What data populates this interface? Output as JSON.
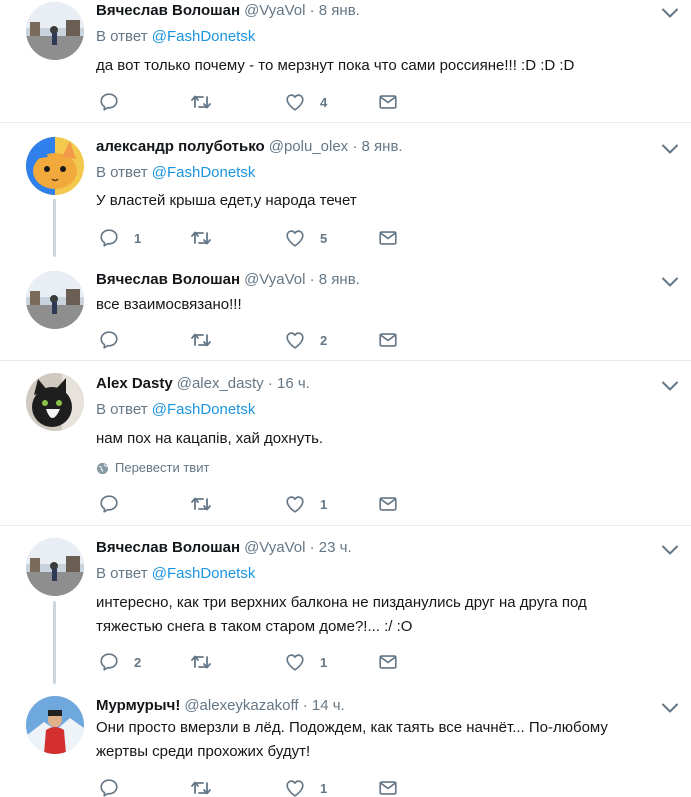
{
  "tweets": [
    {
      "name": "Вячеслав Волошан",
      "handle": "@VyaVol",
      "time": "8 янв.",
      "reply_prefix": "В ответ",
      "reply_to": "@FashDonetsk",
      "text": "да вот только почему - то мерзнут пока что сами россияне!!! :D :D :D",
      "counts": {
        "reply": "",
        "retweet": "",
        "like": "4"
      }
    },
    {
      "name": "александр полуботько",
      "handle": "@polu_olex",
      "time": "8 янв.",
      "reply_prefix": "В ответ",
      "reply_to": "@FashDonetsk",
      "text": "У властей крыша едет,у народа течет",
      "counts": {
        "reply": "1",
        "retweet": "",
        "like": "5"
      }
    },
    {
      "name": "Вячеслав Волошан",
      "handle": "@VyaVol",
      "time": "8 янв.",
      "text": "все взаимосвязано!!!",
      "counts": {
        "reply": "",
        "retweet": "",
        "like": "2"
      }
    },
    {
      "name": "Alex Dasty",
      "handle": "@alex_dasty",
      "time": "16 ч.",
      "reply_prefix": "В ответ",
      "reply_to": "@FashDonetsk",
      "text": "нам пох на кацапів, хай дохнуть.",
      "translate": "Перевести твит",
      "counts": {
        "reply": "",
        "retweet": "",
        "like": "1"
      }
    },
    {
      "name": "Вячеслав Волошан",
      "handle": "@VyaVol",
      "time": "23 ч.",
      "reply_prefix": "В ответ",
      "reply_to": "@FashDonetsk",
      "text": "интересно, как три верхних балкона не пизданулись друг на друга под тяжестью снега в таком старом доме?!... :/ :O",
      "counts": {
        "reply": "2",
        "retweet": "",
        "like": "1"
      }
    },
    {
      "name": "Мурмурыч!",
      "handle": "@alexeykazakoff",
      "time": "14 ч.",
      "text": "Они просто вмерзли в лёд. Подождем, как таять все начнёт... По-любому жертвы среди прохожих будут!",
      "counts": {
        "reply": "",
        "retweet": "",
        "like": "1"
      }
    }
  ],
  "separator": "·",
  "icons": [
    "reply-icon",
    "retweet-icon",
    "like-icon",
    "dm-icon",
    "caret-down-icon",
    "globe-icon"
  ],
  "colors": {
    "link": "#1b95e0",
    "muted": "#657786",
    "text": "#14171a",
    "divider": "#e6ecf0",
    "thread": "#ccd6dd"
  }
}
